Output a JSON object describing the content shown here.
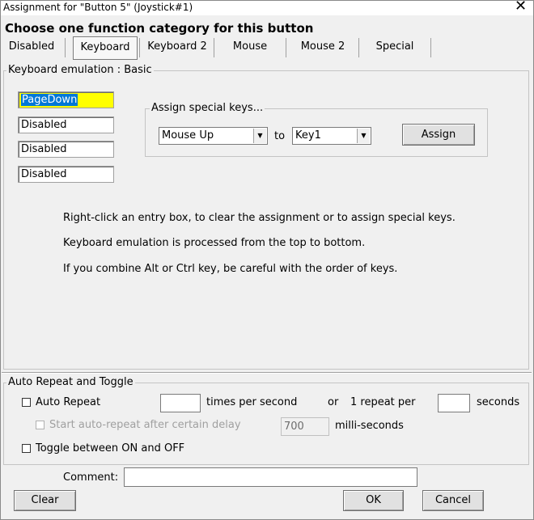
{
  "window": {
    "title": "Assignment for \"Button 5\" (Joystick#1)"
  },
  "heading": "Choose one function category for this button",
  "tabs": [
    {
      "label": "Disabled"
    },
    {
      "label": "Keyboard"
    },
    {
      "label": "Keyboard 2"
    },
    {
      "label": "Mouse"
    },
    {
      "label": "Mouse 2"
    },
    {
      "label": "Special"
    }
  ],
  "active_tab": "Keyboard",
  "keyboard_group": {
    "label": "Keyboard emulation : Basic",
    "entries": [
      "PageDown",
      "Disabled",
      "Disabled",
      "Disabled"
    ],
    "special": {
      "label": "Assign special keys...",
      "from_value": "Mouse Up",
      "to_label": "to",
      "to_value": "Key1",
      "assign_label": "Assign"
    },
    "info": [
      "Right-click an entry box, to clear the assignment or to assign special keys.",
      "Keyboard emulation is processed from the top to bottom.",
      "If you combine Alt or Ctrl key, be careful with the order of keys."
    ]
  },
  "auto_group": {
    "label": "Auto Repeat and Toggle",
    "auto_repeat_label": "Auto Repeat",
    "times_label": "times per second",
    "or_label": "or",
    "one_repeat_label": "1 repeat per",
    "seconds_label": "seconds",
    "delay_label": "Start auto-repeat after certain delay",
    "delay_value": "700",
    "ms_label": "milli-seconds",
    "toggle_label": "Toggle between ON and OFF"
  },
  "footer": {
    "comment_label": "Comment:",
    "comment_value": "",
    "clear_label": "Clear",
    "ok_label": "OK",
    "cancel_label": "Cancel"
  }
}
